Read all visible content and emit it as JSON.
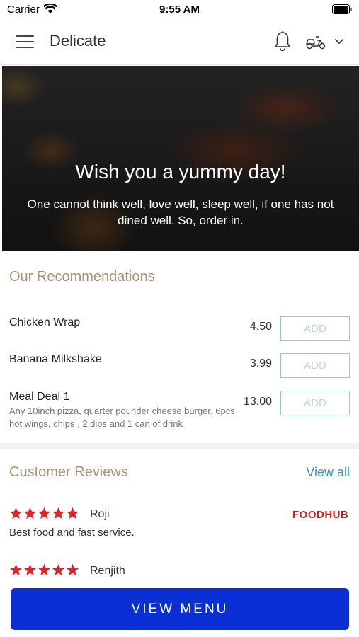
{
  "status_bar": {
    "carrier": "Carrier",
    "time": "9:55 AM"
  },
  "header": {
    "title": "Delicate",
    "icons": [
      "menu-icon",
      "bell-icon",
      "scooter-icon",
      "chevron-down-icon"
    ]
  },
  "hero": {
    "title": "Wish you a yummy day!",
    "subtitle": "One cannot think well, love well, sleep well, if one has not dined well. So, order in."
  },
  "recommendations": {
    "title": "Our Recommendations",
    "add_label": "ADD",
    "items": [
      {
        "name": "Chicken Wrap",
        "description": "",
        "price": "4.50"
      },
      {
        "name": "Banana Milkshake",
        "description": "",
        "price": "3.99"
      },
      {
        "name": "Meal Deal 1",
        "description": "Any 10inch pizza, quarter pounder cheese burger, 6pcs hot wings, chips , 2 dips and 1 can of drink",
        "price": "13.00"
      }
    ]
  },
  "reviews": {
    "title": "Customer Reviews",
    "view_all": "View all",
    "items": [
      {
        "name": "Roji",
        "rating": 5,
        "text": "Best food and fast service.",
        "source": "FOODHUB"
      },
      {
        "name": "Renjith",
        "rating": 5,
        "text": "",
        "source": ""
      }
    ]
  },
  "cta": {
    "label": "VIEW MENU"
  },
  "colors": {
    "accent_gold": "#a89272",
    "link_blue": "#2a9bc4",
    "button_blue": "#0a2fd4",
    "star_red": "#d9262c",
    "add_border_green": "#8fd0b0",
    "foodhub_red": "#c8241d"
  }
}
